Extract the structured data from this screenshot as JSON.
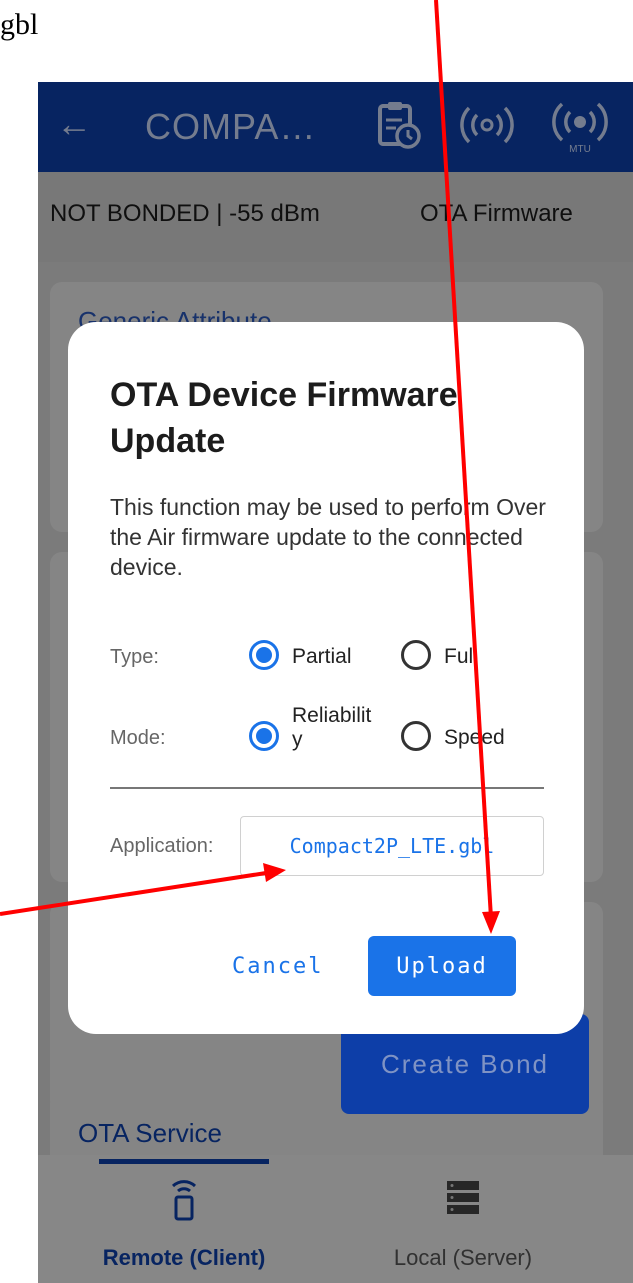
{
  "caption_fragment": "gbl",
  "appbar": {
    "back_icon": "arrow-left-icon",
    "title": "COMPA…",
    "icons": [
      "clipboard-clock-icon",
      "broadcast-icon",
      "broadcast-mtu-icon"
    ],
    "mtu_label": "MTU",
    "color": "#0d3ea8"
  },
  "status": {
    "bond_rssi": "NOT BONDED | -55 dBm",
    "ota_label": "OTA Firmware"
  },
  "cards": {
    "generic_attribute_title": "Generic Attribute",
    "ota_service_title": "OTA Service",
    "create_bond_label": "Create Bond"
  },
  "dialog": {
    "title": "OTA Device Firmware Update",
    "description": "This function may be used to perform Over the Air firmware update to the connected device.",
    "type_label": "Type:",
    "type_options": [
      "Partial",
      "Full"
    ],
    "type_selected": "Partial",
    "mode_label": "Mode:",
    "mode_options": [
      "Reliability",
      "Speed"
    ],
    "mode_option1_line1": "Reliabilit",
    "mode_option1_line2": "y",
    "mode_selected": "Reliability",
    "application_label": "Application:",
    "application_file": "Compact2P_LTE.gbl",
    "cancel_label": "Cancel",
    "upload_label": "Upload",
    "accent": "#1a73e8"
  },
  "bottom_nav": {
    "items": [
      {
        "label": "Remote (Client)",
        "icon": "remote-device-icon",
        "active": true
      },
      {
        "label": "Local (Server)",
        "icon": "server-icon",
        "active": false
      }
    ]
  },
  "annotation_color": "#ff0000"
}
